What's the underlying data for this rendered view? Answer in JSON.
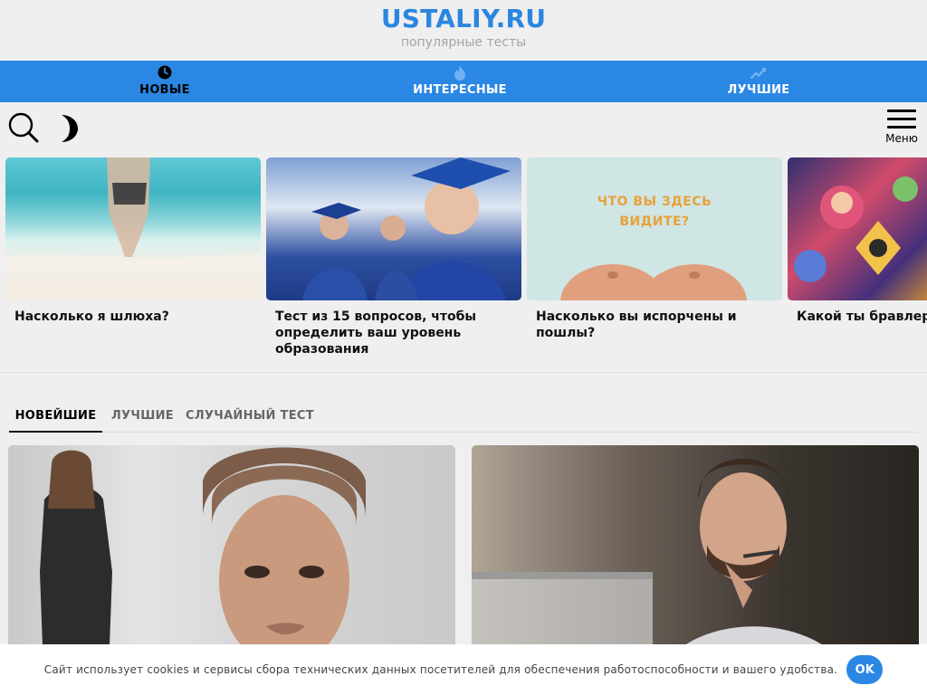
{
  "site": {
    "logo": "USTALIY.RU",
    "tagline": "популярные тесты"
  },
  "top_nav": [
    {
      "label": "НОВЫЕ",
      "icon": "clock-icon",
      "active": true
    },
    {
      "label": "ИНТЕРЕСНЫЕ",
      "icon": "fire-icon",
      "active": false
    },
    {
      "label": "ЛУЧШИЕ",
      "icon": "trending-icon",
      "active": false
    }
  ],
  "toolbar": {
    "search_icon": "search-icon",
    "theme_icon": "moon-icon",
    "menu_label": "Меню"
  },
  "featured": [
    {
      "title": "Насколько я шлюха?"
    },
    {
      "title": "Тест из 15 вопросов, чтобы определить ваш уровень образования"
    },
    {
      "title": "Насколько вы испорчены и пошлы?",
      "image_text": "ЧТО ВЫ ЗДЕСЬ ВИДИТЕ?"
    },
    {
      "title": "Какой ты бравлер и"
    }
  ],
  "tabs": [
    {
      "label": "НОВЕЙШИЕ",
      "active": true
    },
    {
      "label": "ЛУЧШИЕ",
      "active": false
    },
    {
      "label": "СЛУЧАЙНЫЙ ТЕСТ",
      "active": false
    }
  ],
  "cookie": {
    "text": "Сайт использует cookies и сервисы сбора технических данных посетителей для обеспечения работоспособности и вашего удобства.",
    "button": "OK"
  },
  "colors": {
    "accent": "#2a87e4",
    "background": "#efefef"
  }
}
